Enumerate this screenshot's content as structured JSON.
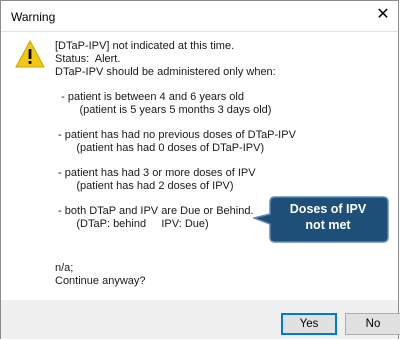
{
  "window": {
    "title": "Warning",
    "close_glyph": "✕"
  },
  "icon": {
    "name": "warning-icon",
    "color": "#f2c811"
  },
  "message": {
    "lines": [
      "[DTaP-IPV] not indicated at this time.",
      "Status:  Alert.",
      "DTaP-IPV should be administered only when:"
    ],
    "conditions": [
      {
        "rule": "  - patient is between 4 and 6 years old",
        "detail": "        (patient is 5 years 5 months 3 days old)"
      },
      {
        "rule": " - patient has had no previous doses of DTaP-IPV",
        "detail": "       (patient has had 0 doses of DTaP-IPV)"
      },
      {
        "rule": " - patient has had 3 or more doses of IPV",
        "detail": "       (patient has had 2 doses of IPV)"
      },
      {
        "rule": " - both DTaP and IPV are Due or Behind.",
        "detail": "       (DTaP: behind     IPV: Due)"
      }
    ],
    "footer_lines": [
      "n/a;",
      "Continue anyway?"
    ]
  },
  "callout": {
    "line1": "Doses of IPV",
    "line2": "not met",
    "color": "#1e4f78"
  },
  "buttons": {
    "yes": "Yes",
    "no": "No"
  }
}
